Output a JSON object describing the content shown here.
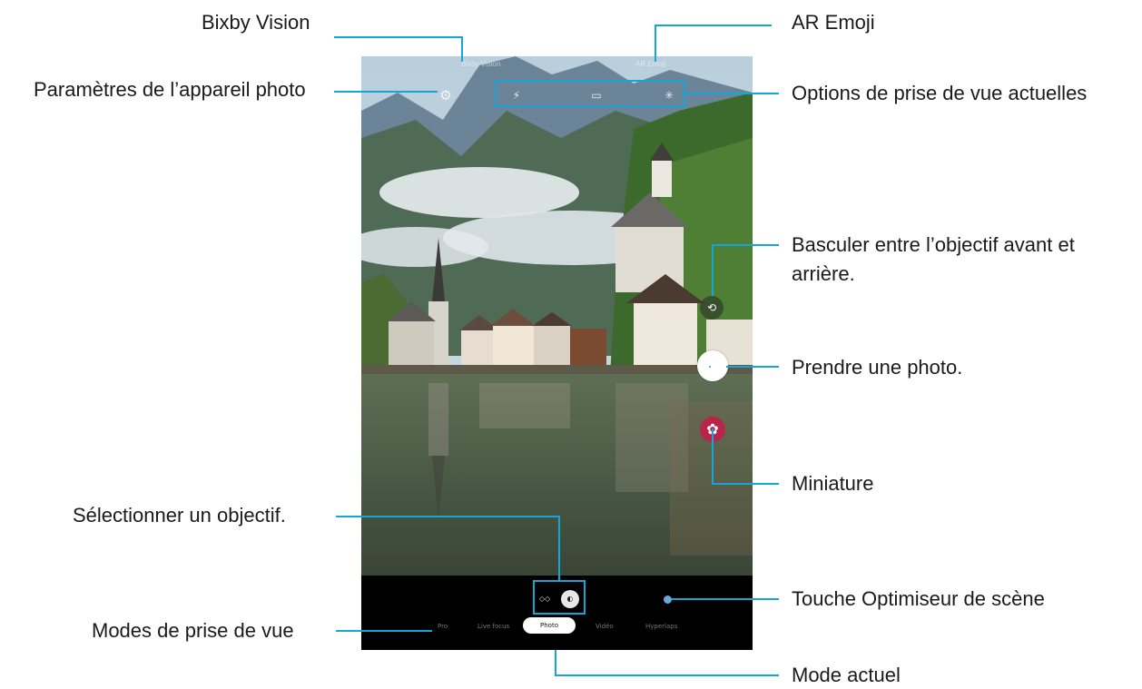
{
  "callouts": {
    "bixby_vision": "Bixby Vision",
    "camera_settings": "Paramètres de l’appareil photo",
    "ar_emoji": "AR Emoji",
    "current_options": "Options de prise de vue actuelles",
    "switch_camera_line1": "Basculer entre l’objectif avant et",
    "switch_camera_line2": "arrière.",
    "take_photo": "Prendre une photo.",
    "thumbnail": "Miniature",
    "select_lens": "Sélectionner un objectif.",
    "scene_optimizer": "Touche Optimiseur de scène",
    "shooting_modes": "Modes de prise de vue",
    "current_mode": "Mode actuel"
  },
  "screen": {
    "top_left_label": "Bixby Vision",
    "top_right_label": "AR Emoji",
    "modes": [
      "Pro",
      "Live focus",
      "Photo",
      "Vidéo",
      "Hyperlaps"
    ],
    "current_mode": "Photo"
  },
  "icons": {
    "settings": "gear-icon",
    "options": [
      "flash-icon",
      "ratio-icon",
      "effects-icon"
    ],
    "switch_camera": "switch-camera-icon",
    "thumbnail": "flower-icon",
    "lens": [
      "wide-lens-icon",
      "normal-lens-icon"
    ]
  },
  "colors": {
    "highlight": "#14a6d6",
    "thumbnail": "#b8244a",
    "scene_optimizer": "#6fa7d6"
  }
}
